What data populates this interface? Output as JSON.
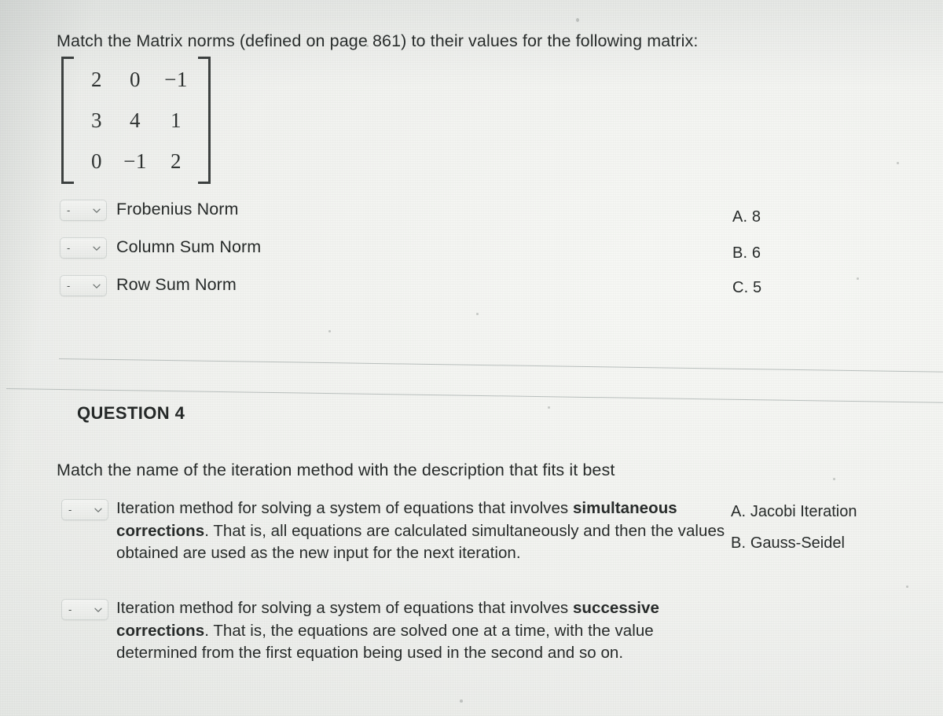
{
  "question3": {
    "prompt": "Match the Matrix norms (defined on page 861) to their values for the following matrix:",
    "matrix": [
      [
        "2",
        "0",
        "−1"
      ],
      [
        "3",
        "4",
        "1"
      ],
      [
        "0",
        "−1",
        "2"
      ]
    ],
    "dropdown_value": "-",
    "dropdown_icon": "chevron-down-icon",
    "items": [
      {
        "label": "Frobenius Norm"
      },
      {
        "label": "Column Sum Norm"
      },
      {
        "label": "Row Sum Norm"
      }
    ],
    "options": [
      {
        "letter": "A.",
        "text": "8"
      },
      {
        "letter": "B.",
        "text": "6"
      },
      {
        "letter": "C.",
        "text": "5"
      }
    ]
  },
  "question4": {
    "heading": "QUESTION 4",
    "prompt": "Match the name of the iteration method with the description that fits it best",
    "dropdown_value": "-",
    "dropdown_icon": "chevron-down-icon",
    "items": [
      {
        "text_before": "Iteration method for solving a system of equations that involves ",
        "bold": "simultaneous corrections",
        "text_after": ". That is, all equations are calculated simultaneously and then the values obtained are used as the new input for the next iteration."
      },
      {
        "text_before": "Iteration method for solving a system of equations that involves ",
        "bold": "successive corrections",
        "text_after": ". That is, the equations are solved one at a time, with the value determined from the first equation being used in the second and so on."
      }
    ],
    "options": [
      {
        "letter": "A.",
        "text": "Jacobi Iteration"
      },
      {
        "letter": "B.",
        "text": "Gauss-Seidel"
      }
    ]
  },
  "colors": {
    "page_background": "#eceeec",
    "text": "#242827",
    "divider": "#b9bfbd",
    "dropdown_border": "#d2d6d4"
  }
}
